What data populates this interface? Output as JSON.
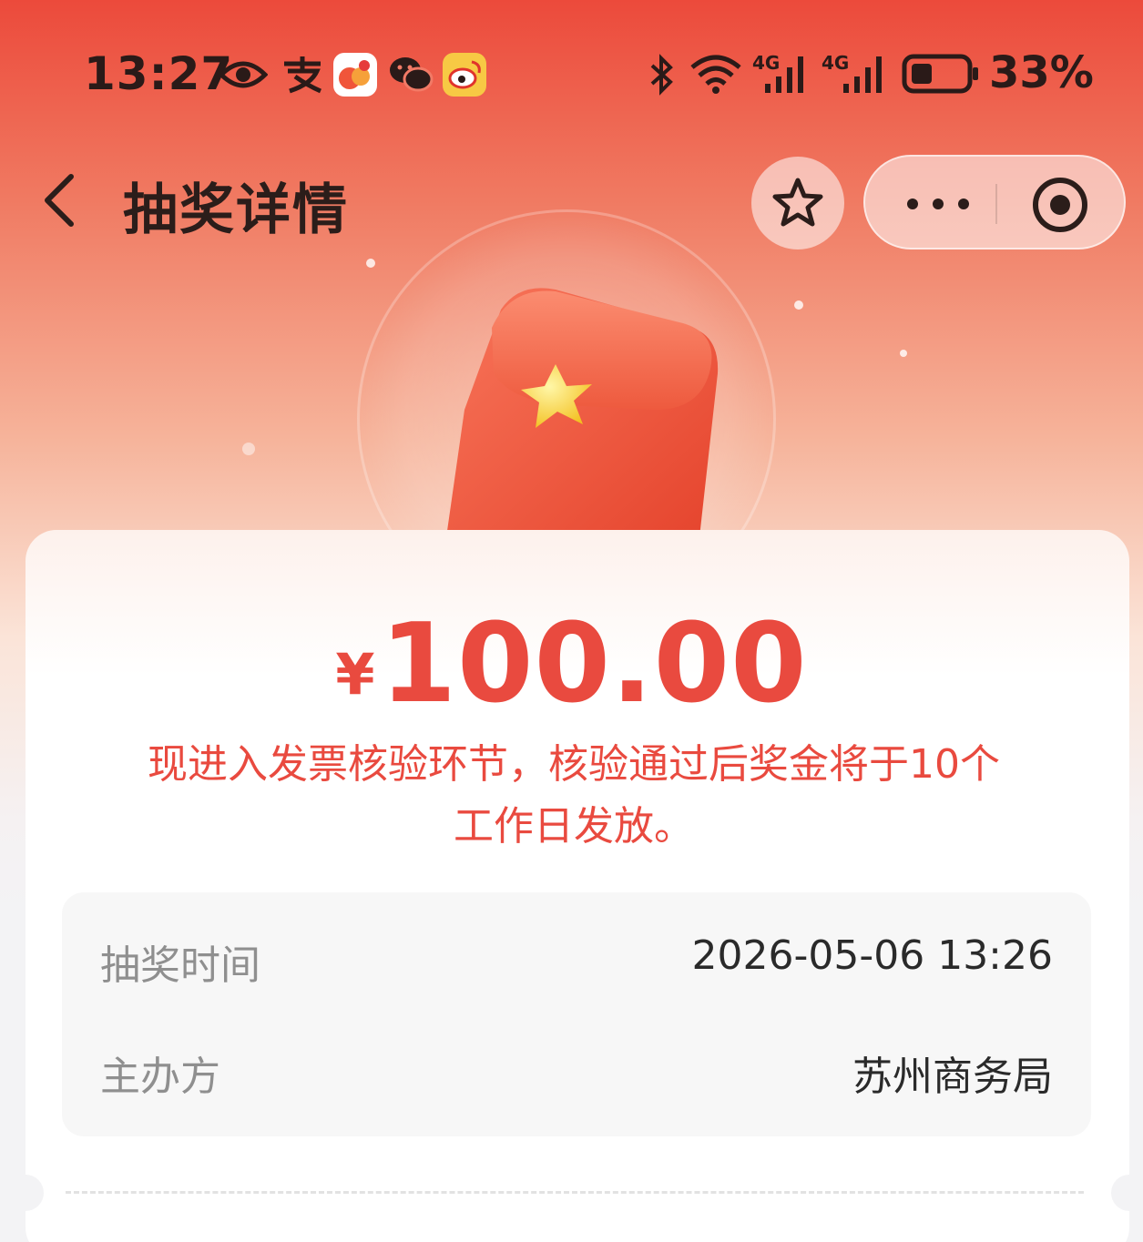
{
  "status_bar": {
    "time": "13:27",
    "battery": "33%",
    "icons": [
      "eye-icon",
      "alipay-icon",
      "app-icon",
      "wechat-icon",
      "weibo-icon",
      "bluetooth-icon",
      "wifi-icon",
      "signal-4g-icon",
      "signal-4g-icon",
      "battery-icon"
    ],
    "network_labels": [
      "4G",
      "4G"
    ]
  },
  "nav": {
    "title": "抽奖详情"
  },
  "prize": {
    "currency": "¥",
    "amount": "100.00",
    "notice": "现进入发票核验环节，核验通过后奖金将于10个工作日发放。"
  },
  "details": {
    "rows": [
      {
        "label": "抽奖时间",
        "value": "2026-05-06 13:26"
      },
      {
        "label": "主办方",
        "value": "苏州商务局"
      }
    ]
  },
  "colors": {
    "accent": "#e94a3f",
    "header_top": "#ec4a3b"
  }
}
